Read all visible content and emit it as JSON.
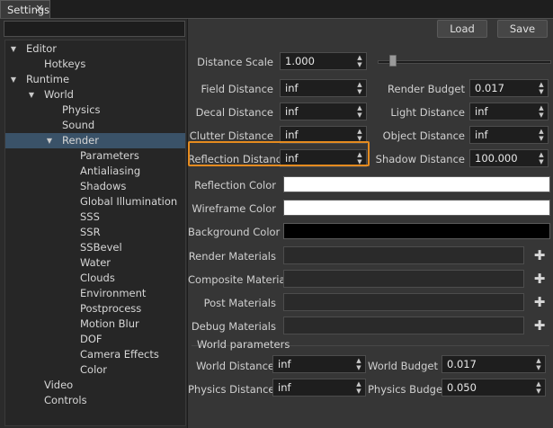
{
  "tab": {
    "label": "Settings"
  },
  "search": {
    "placeholder": ""
  },
  "tree": [
    {
      "label": "Editor",
      "expanded": true
    },
    {
      "label": "Hotkeys"
    },
    {
      "label": "Runtime",
      "expanded": true
    },
    {
      "label": "World",
      "expanded": true
    },
    {
      "label": "Physics"
    },
    {
      "label": "Sound"
    },
    {
      "label": "Render",
      "expanded": true,
      "selected": true
    },
    {
      "label": "Parameters"
    },
    {
      "label": "Antialiasing"
    },
    {
      "label": "Shadows"
    },
    {
      "label": "Global Illumination"
    },
    {
      "label": "SSS"
    },
    {
      "label": "SSR"
    },
    {
      "label": "SSBevel"
    },
    {
      "label": "Water"
    },
    {
      "label": "Clouds"
    },
    {
      "label": "Environment"
    },
    {
      "label": "Postprocess"
    },
    {
      "label": "Motion Blur"
    },
    {
      "label": "DOF"
    },
    {
      "label": "Camera Effects"
    },
    {
      "label": "Color"
    },
    {
      "label": "Video"
    },
    {
      "label": "Controls"
    }
  ],
  "toolbar": {
    "load_label": "Load",
    "save_label": "Save"
  },
  "distance_scale": {
    "label": "Distance Scale",
    "value": "1.000"
  },
  "left_fields": [
    {
      "label": "Field Distance",
      "value": "inf"
    },
    {
      "label": "Decal Distance",
      "value": "inf"
    },
    {
      "label": "Clutter Distance",
      "value": "inf"
    },
    {
      "label": "Reflection Distance",
      "value": "inf"
    }
  ],
  "right_fields": [
    {
      "label": "Render Budget",
      "value": "0.017"
    },
    {
      "label": "Light Distance",
      "value": "inf"
    },
    {
      "label": "Object Distance",
      "value": "inf"
    },
    {
      "label": "Shadow Distance",
      "value": "100.000"
    }
  ],
  "colors": [
    {
      "label": "Reflection Color",
      "color": "#ffffff"
    },
    {
      "label": "Wireframe Color",
      "color": "#ffffff"
    },
    {
      "label": "Background Color",
      "color": "#000000"
    }
  ],
  "materials": [
    {
      "label": "Render Materials"
    },
    {
      "label": "Composite Materials"
    },
    {
      "label": "Post Materials"
    },
    {
      "label": "Debug Materials"
    }
  ],
  "world": {
    "title": "World parameters",
    "world_distance": {
      "label": "World Distance",
      "value": "inf"
    },
    "world_budget": {
      "label": "World Budget",
      "value": "0.017"
    },
    "physics_distance": {
      "label": "Physics Distance",
      "value": "inf"
    },
    "physics_budget": {
      "label": "Physics Budget",
      "value": "0.050"
    }
  },
  "accent_colors": {
    "selection": "#3a5268",
    "highlight": "#e58b1f"
  }
}
